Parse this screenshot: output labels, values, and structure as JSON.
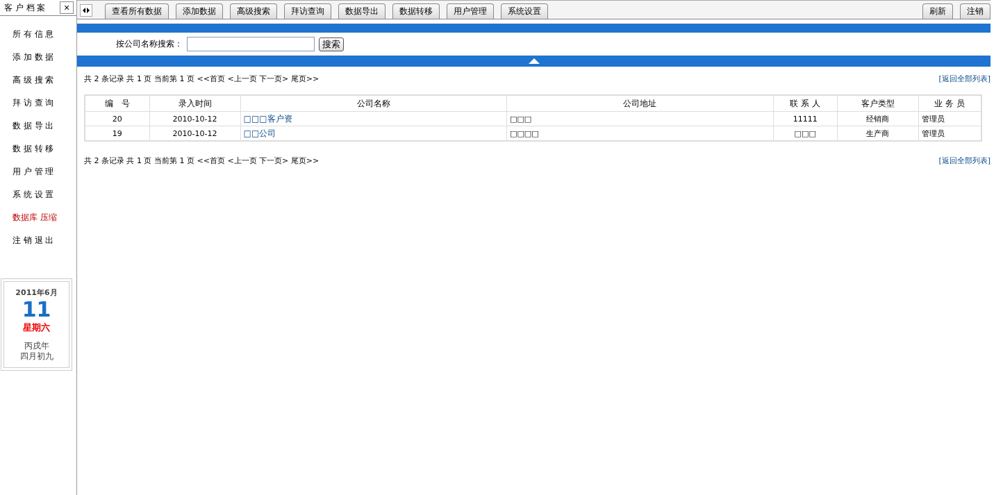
{
  "sidebar": {
    "title": "客 户 档 案",
    "close": "×",
    "items": [
      {
        "label": "所 有 信 息",
        "highlighted": false
      },
      {
        "label": "添 加 数 据",
        "highlighted": false
      },
      {
        "label": "高 级 搜 索",
        "highlighted": false
      },
      {
        "label": "拜 访 查 询",
        "highlighted": false
      },
      {
        "label": "数 据 导 出",
        "highlighted": false
      },
      {
        "label": "数 据 转 移",
        "highlighted": false
      },
      {
        "label": "用 户 管 理",
        "highlighted": false
      },
      {
        "label": "系 统 设 置",
        "highlighted": false
      },
      {
        "label": "数据库 压缩",
        "highlighted": true
      },
      {
        "label": "注 销 退 出",
        "highlighted": false
      }
    ],
    "calendar": {
      "year_month": "2011年6月",
      "day": "11",
      "weekday": "星期六",
      "lunar_year": "丙戌年",
      "lunar_date": "四月初九"
    }
  },
  "toolbar": {
    "tabs": [
      "查看所有数据",
      "添加数据",
      "高级搜索",
      "拜访查询",
      "数据导出",
      "数据转移",
      "用户管理",
      "系统设置"
    ],
    "right_buttons": [
      "刷新",
      "注销"
    ]
  },
  "search": {
    "label": "按公司名称搜索：",
    "button": "搜索"
  },
  "pager_top": {
    "text": "共 2 条记录 共 1 页 当前第 1 页 <<首页 <上一页 下一页> 尾页>>",
    "link": "[返回全部列表]"
  },
  "table": {
    "columns": [
      "编　号",
      "录入时间",
      "公司名称",
      "公司地址",
      "联 系 人",
      "客户类型",
      "业 务 员"
    ],
    "rows": [
      {
        "cells": [
          "20",
          "2010-10-12",
          "□□□客户资",
          "□□□",
          "11111",
          "经销商",
          "管理员"
        ]
      },
      {
        "cells": [
          "19",
          "2010-10-12",
          "□□公司",
          "□□□□",
          "□□□",
          "生产商",
          "管理员"
        ]
      }
    ]
  },
  "pager_bottom": {
    "text": "共 2 条记录 共 1 页 当前第 1 页 <<首页 <上一页 下一页> 尾页>>",
    "link": "[返回全部列表]"
  }
}
